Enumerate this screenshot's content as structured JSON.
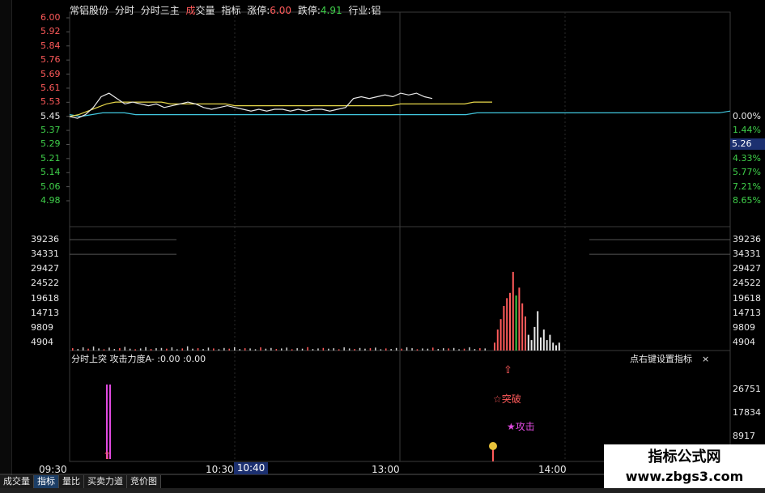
{
  "title": {
    "stock_name": "常铝股份",
    "tab_fenshi": "分时",
    "tab_fenshi_sanzhu": "分时三主",
    "tab_chengjiaoliang_cheng": "成",
    "tab_chengjiaoliang_rest": "交量",
    "tab_zhibiao": "指标",
    "limit_up_label": "涨停:",
    "limit_up_value": "6.00",
    "limit_down_label": "跌停:",
    "limit_down_value": "4.91",
    "industry_label": "行业:铝"
  },
  "price_axis_left": [
    {
      "v": "6.00",
      "c": "red"
    },
    {
      "v": "5.92",
      "c": "red"
    },
    {
      "v": "5.84",
      "c": "red"
    },
    {
      "v": "5.76",
      "c": "red"
    },
    {
      "v": "5.69",
      "c": "red"
    },
    {
      "v": "5.61",
      "c": "red"
    },
    {
      "v": "5.53",
      "c": "red"
    },
    {
      "v": "5.45",
      "c": "white"
    },
    {
      "v": "5.37",
      "c": "green"
    },
    {
      "v": "5.29",
      "c": "green"
    },
    {
      "v": "5.21",
      "c": "green"
    },
    {
      "v": "5.14",
      "c": "green"
    },
    {
      "v": "5.06",
      "c": "green"
    },
    {
      "v": "4.98",
      "c": "green"
    }
  ],
  "pct_axis_right": [
    {
      "v": "0.00%",
      "c": "white"
    },
    {
      "v": "1.44%",
      "c": "green"
    },
    {
      "v": "5.26",
      "c": "cursor"
    },
    {
      "v": "4.33%",
      "c": "green"
    },
    {
      "v": "5.77%",
      "c": "green"
    },
    {
      "v": "7.21%",
      "c": "green"
    },
    {
      "v": "8.65%",
      "c": "green"
    }
  ],
  "volume_axis": [
    "39236",
    "34331",
    "29427",
    "24522",
    "19618",
    "14713",
    "9809",
    "4904"
  ],
  "indicator": {
    "title": "分时上突  攻击力度A- :0.00 :0.00",
    "right_hint": "点右键设置指标",
    "close_glyph": "×",
    "axis": [
      "26751",
      "17834",
      "8917"
    ],
    "signal_breakout": "☆突破",
    "signal_attack": "★攻击",
    "arrow_glyph": "⇧"
  },
  "time_axis": [
    "09:30",
    "10:30",
    "13:00",
    "14:00"
  ],
  "time_cursor": "10:40",
  "tabs": [
    {
      "label": "成交量",
      "active": false
    },
    {
      "label": "指标",
      "active": true
    },
    {
      "label": "量比",
      "active": false
    },
    {
      "label": "买卖力道",
      "active": false
    },
    {
      "label": "竞价图",
      "active": false
    }
  ],
  "watermark": {
    "line1": "指标公式网",
    "line2": "www.zbgs3.com"
  },
  "colors": {
    "up": "#ff5a5a",
    "down": "#3fd04a",
    "price_line": "#e8e8e8",
    "avg_line": "#e8d84a",
    "base_line": "#42c8e0",
    "cursor_bg": "#1c3070"
  },
  "chart_data": {
    "type": "line",
    "price_range": [
      4.98,
      6.0
    ],
    "prev_close": 5.45,
    "price_series": [
      5.45,
      5.44,
      5.46,
      5.5,
      5.56,
      5.58,
      5.55,
      5.52,
      5.53,
      5.52,
      5.51,
      5.52,
      5.5,
      5.51,
      5.52,
      5.53,
      5.52,
      5.5,
      5.49,
      5.5,
      5.51,
      5.5,
      5.49,
      5.48,
      5.49,
      5.48,
      5.49,
      5.49,
      5.48,
      5.49,
      5.48,
      5.49,
      5.49,
      5.48,
      5.49,
      5.5,
      5.55,
      5.56,
      5.55,
      5.56,
      5.57,
      5.56,
      5.58,
      5.57,
      5.58,
      5.56,
      5.55
    ],
    "avg_series": [
      5.45,
      5.46,
      5.48,
      5.5,
      5.52,
      5.53,
      5.53,
      5.53,
      5.53,
      5.53,
      5.53,
      5.52,
      5.52,
      5.52,
      5.52,
      5.52,
      5.52,
      5.52,
      5.51,
      5.51,
      5.51,
      5.51,
      5.51,
      5.51,
      5.51,
      5.51,
      5.51,
      5.51,
      5.51,
      5.51,
      5.51,
      5.51,
      5.51,
      5.51,
      5.51,
      5.51,
      5.52,
      5.52,
      5.52,
      5.52,
      5.52,
      5.52,
      5.52,
      5.52,
      5.53,
      5.53,
      5.53
    ],
    "base_series": [
      5.46,
      5.45,
      5.46,
      5.47,
      5.47,
      5.47,
      5.46,
      5.46,
      5.46,
      5.46,
      5.46,
      5.46,
      5.46,
      5.46,
      5.46,
      5.46,
      5.46,
      5.46,
      5.46,
      5.46,
      5.46,
      5.46,
      5.46,
      5.46,
      5.46,
      5.46,
      5.46,
      5.46,
      5.46,
      5.46,
      5.46,
      5.46,
      5.46,
      5.46,
      5.46,
      5.46,
      5.46,
      5.47,
      5.47,
      5.47,
      5.47,
      5.47,
      5.47,
      5.47,
      5.47,
      5.47,
      5.47,
      5.47,
      5.47,
      5.47,
      5.47,
      5.47,
      5.47,
      5.47,
      5.47,
      5.47,
      5.47,
      5.47,
      5.47,
      5.47,
      5.48
    ],
    "volume_max": 39236,
    "volume_small": [
      900,
      600,
      1200,
      700,
      1500,
      800,
      500,
      1100,
      600,
      900,
      1400,
      700,
      500,
      800,
      1300,
      600,
      900,
      1000,
      700,
      1200,
      500,
      800,
      1600,
      700,
      900,
      600,
      1100,
      800,
      500,
      1000,
      700,
      1300,
      600,
      900,
      800,
      500,
      1200,
      700,
      1000,
      600,
      800,
      1100,
      500,
      900,
      700,
      1300,
      600,
      800,
      1000,
      700,
      900,
      500,
      1200,
      800,
      600,
      1000,
      700,
      900,
      1100,
      500,
      800,
      600,
      1000,
      700,
      1200,
      900,
      500,
      800,
      700,
      1100,
      600,
      900,
      800,
      1000,
      500,
      700,
      1200,
      600,
      900,
      800
    ],
    "volume_spike": [
      {
        "v": 3000,
        "c": "red"
      },
      {
        "v": 8000,
        "c": "red"
      },
      {
        "v": 12000,
        "c": "red"
      },
      {
        "v": 17000,
        "c": "red"
      },
      {
        "v": 20000,
        "c": "red"
      },
      {
        "v": 22000,
        "c": "red"
      },
      {
        "v": 30000,
        "c": "red"
      },
      {
        "v": 21000,
        "c": "green"
      },
      {
        "v": 24000,
        "c": "red"
      },
      {
        "v": 18000,
        "c": "red"
      },
      {
        "v": 13000,
        "c": "red"
      },
      {
        "v": 6000,
        "c": "white"
      },
      {
        "v": 4000,
        "c": "white"
      },
      {
        "v": 9000,
        "c": "white"
      },
      {
        "v": 15000,
        "c": "white"
      },
      {
        "v": 5000,
        "c": "white"
      },
      {
        "v": 8000,
        "c": "white"
      },
      {
        "v": 4000,
        "c": "white"
      },
      {
        "v": 6000,
        "c": "white"
      },
      {
        "v": 3000,
        "c": "white"
      },
      {
        "v": 2000,
        "c": "white"
      },
      {
        "v": 3000,
        "c": "white"
      }
    ]
  }
}
